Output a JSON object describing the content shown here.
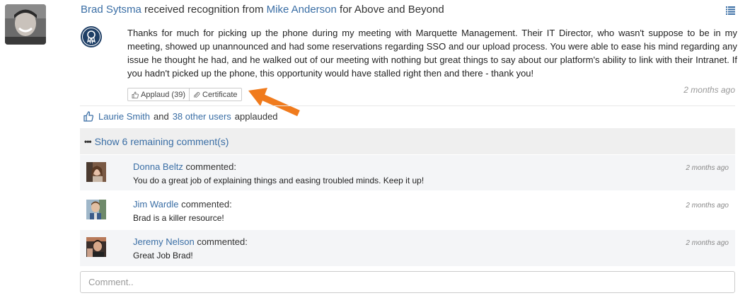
{
  "post": {
    "author": "Brad Sytsma",
    "received_text": "received recognition from",
    "giver": "Mike Anderson",
    "for_text": "for Above and Beyond",
    "message": "Thanks for much for picking up the phone during my meeting with Marquette Management. Their IT Director, who wasn't suppose to be in my meeting, showed up unannounced and had some reservations regarding SSO and our upload process. You were able to ease his mind regarding any issue he thought he had, and he walked out of our meeting with nothing but great things to say about our platform's ability to link with their Intranet. If you hadn't picked up the phone, this opportunity would have stalled right then and there - thank you!",
    "time": "2 months ago",
    "applaud_label": "Applaud (39)",
    "certificate_label": "Certificate"
  },
  "applause": {
    "first_user": "Laurie Smith",
    "and_text": "and",
    "others_link": "38 other users",
    "suffix": "applauded"
  },
  "show_more": {
    "dots": "•••",
    "label": "Show 6 remaining comment(s)"
  },
  "comments": [
    {
      "author": "Donna Beltz",
      "verb": "commented:",
      "text": "You do a great job of explaining things and easing troubled minds. Keep it up!",
      "time": "2 months ago"
    },
    {
      "author": "Jim Wardle",
      "verb": "commented:",
      "text": "Brad is a killer resource!",
      "time": "2 months ago"
    },
    {
      "author": "Jeremy Nelson",
      "verb": "commented:",
      "text": "Great Job Brad!",
      "time": "2 months ago"
    }
  ],
  "comment_box": {
    "placeholder": "Comment.."
  },
  "colors": {
    "link": "#3a6ea5",
    "arrow": "#f07b1d",
    "badge": "#1f3f66",
    "shaded_row": "#f4f5f7"
  }
}
